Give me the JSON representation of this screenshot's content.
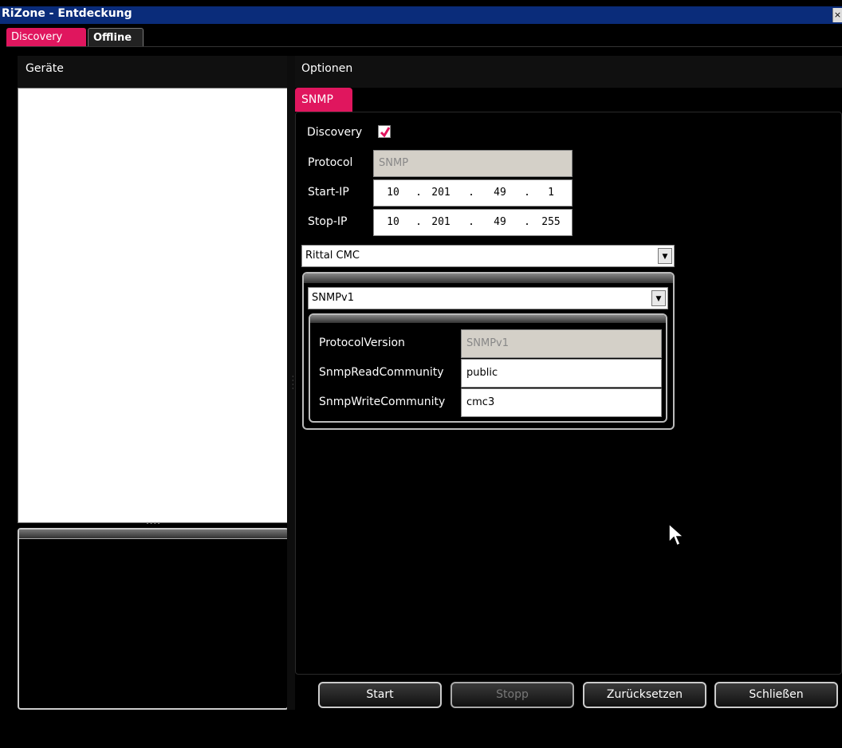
{
  "window": {
    "title": "RiZone - Entdeckung",
    "close_glyph": "×"
  },
  "tabs": {
    "discovery": "Discovery",
    "offline": "Offline"
  },
  "left": {
    "title": "Geräte"
  },
  "right": {
    "title": "Optionen",
    "snmp_tab": "SNMP",
    "discovery_label": "Discovery",
    "discovery_checked": true,
    "protocol_label": "Protocol",
    "protocol_value": "SNMP",
    "start_ip_label": "Start-IP",
    "start_ip": [
      "10",
      "201",
      "49",
      "1"
    ],
    "stop_ip_label": "Stop-IP",
    "stop_ip": [
      "10",
      "201",
      "49",
      "255"
    ],
    "device_type": "Rittal CMC",
    "snmp_version": "SNMPv1",
    "props": {
      "protocol_version_label": "ProtocolVersion",
      "protocol_version_value": "SNMPv1",
      "read_community_label": "SnmpReadCommunity",
      "read_community_value": "public",
      "write_community_label": "SnmpWriteCommunity",
      "write_community_value": "cmc3"
    }
  },
  "buttons": {
    "start": "Start",
    "stop": "Stopp",
    "reset": "Zurücksetzen",
    "close": "Schließen"
  },
  "icons": {
    "check": "checkmark-icon",
    "dropdown": "chevron-down-icon",
    "cursor": "mouse-pointer-icon"
  },
  "colors": {
    "accent": "#e0165e",
    "title_bar": "#0a2c7a"
  }
}
